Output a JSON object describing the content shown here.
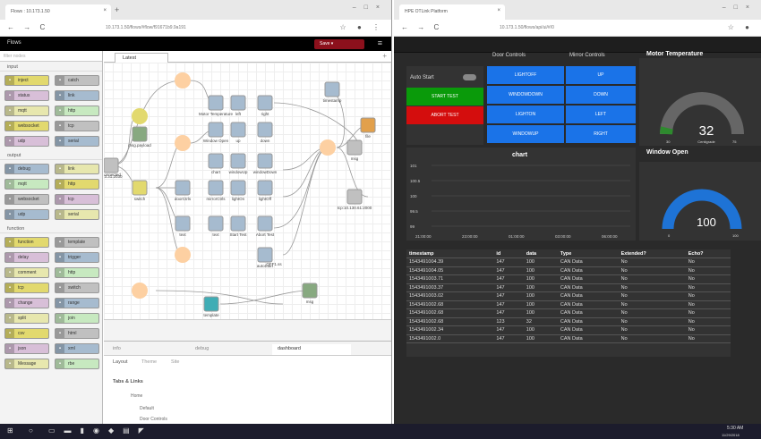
{
  "left": {
    "tab": "Flows : 10.173.1.50",
    "url": "10.173.1.50/flows/#flow/f91671b9.9a191",
    "app": "Flows",
    "deploy": "Save",
    "filter": "filter nodes",
    "ws_tab": "Latest",
    "cats": [
      {
        "label": "input",
        "nodes": [
          "inject",
          "catch",
          "status",
          "link",
          "mqtt",
          "http",
          "websocket",
          "tcp",
          "udp",
          "serial"
        ]
      },
      {
        "label": "output",
        "nodes": [
          "debug",
          "link",
          "mqtt",
          "http",
          "websocket",
          "tcp",
          "udp",
          "serial"
        ]
      },
      {
        "label": "function",
        "nodes": [
          "function",
          "template",
          "delay",
          "trigger",
          "comment",
          "http",
          "tcp",
          "switch",
          "change",
          "range",
          "split",
          "join",
          "csv",
          "html",
          "json",
          "xml",
          "Message",
          "rbe"
        ]
      }
    ],
    "flow": {
      "labels": [
        "Motor Temperature",
        "left",
        "right",
        "msg.payload",
        "Window Open",
        "up",
        "down",
        "timestamp",
        "file",
        "chart",
        "windowUp",
        "windowDown",
        "msg",
        "doorCtrls",
        "173.31.2030",
        "switch",
        "mirrorCtrls",
        "lightOn",
        "lightOff",
        "tcp:10.130.61:2000",
        "text",
        "text",
        "Start Test",
        "Abort Test",
        "autoStart",
        "template",
        "msg",
        "Connected",
        "OFF1.ss"
      ]
    },
    "sb_tabs": [
      "info",
      "debug",
      "dashboard"
    ],
    "lay_tabs": [
      "Layout",
      "Theme",
      "Site"
    ],
    "tabs_links": "Tabs & Links",
    "tree": [
      "Home",
      "Default",
      "Door Controls"
    ]
  },
  "right": {
    "tab": "HPE OTLink Platform",
    "url": "10.173.1.50/flows/api/ui/#/0",
    "dash": {
      "door": "Door Controls",
      "mirror": "Mirror Controls",
      "mt": "Motor Temperature",
      "auto": "Auto Start",
      "start": "START TEST",
      "abort": "ABORT TEST",
      "door_btns": [
        "LIGHTOFF",
        "WINDOWDOWN",
        "LIGHTON",
        "WINDOWUP"
      ],
      "mir_btns": [
        "UP",
        "DOWN",
        "LEFT",
        "RIGHT"
      ],
      "gauge1": {
        "value": 32,
        "unit": "Centigrade",
        "min": 30,
        "max": 75
      },
      "chart": "chart",
      "wo": "Window Open",
      "gauge2": {
        "value": 100,
        "min": 0,
        "max": 100
      },
      "chart_data": {
        "type": "line",
        "title": "chart",
        "yticks": [
          "101",
          "100.5",
          "100",
          "99.5",
          "99"
        ],
        "xticks": [
          "21:00:00",
          "23:00:00",
          "01:00:00",
          "03:00:00",
          "06:00:00"
        ]
      },
      "cols": [
        "timestamp",
        "id",
        "data",
        "Type",
        "Extended?",
        "Echo?"
      ],
      "rows": [
        [
          "1543491004.39",
          "147",
          "100",
          "CAN Data",
          "No",
          "No"
        ],
        [
          "1543491004.05",
          "147",
          "100",
          "CAN Data",
          "No",
          "No"
        ],
        [
          "1543491003.71",
          "147",
          "100",
          "CAN Data",
          "No",
          "No"
        ],
        [
          "1543491003.37",
          "147",
          "100",
          "CAN Data",
          "No",
          "No"
        ],
        [
          "1543491003.02",
          "147",
          "100",
          "CAN Data",
          "No",
          "No"
        ],
        [
          "1543491002.68",
          "147",
          "100",
          "CAN Data",
          "No",
          "No"
        ],
        [
          "1543491002.68",
          "147",
          "100",
          "CAN Data",
          "No",
          "No"
        ],
        [
          "1543491002.68",
          "123",
          "32",
          "CAN Data",
          "No",
          "No"
        ],
        [
          "1543491002.34",
          "147",
          "100",
          "CAN Data",
          "No",
          "No"
        ],
        [
          "1543491002.0",
          "147",
          "100",
          "CAN Data",
          "No",
          "No"
        ]
      ]
    }
  },
  "taskbar": {
    "time": "5:30 AM",
    "date": "11/29/2018"
  }
}
